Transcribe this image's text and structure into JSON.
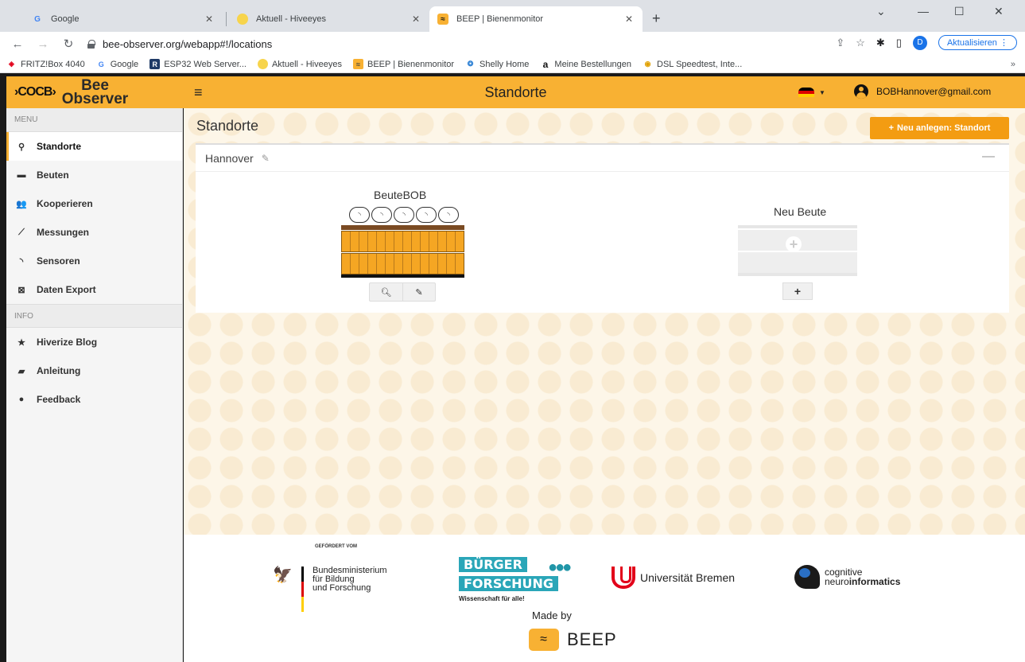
{
  "browser": {
    "tabs": [
      {
        "title": "Google",
        "favicon": "G"
      },
      {
        "title": "Aktuell - Hiveeyes",
        "favicon": ""
      },
      {
        "title": "BEEP | Bienenmonitor",
        "favicon": ""
      }
    ],
    "url": "bee-observer.org/webapp#!/locations",
    "update_label": "Aktualisieren",
    "profile_initial": "D",
    "bookmarks": [
      {
        "label": "FRITZ!Box 4040",
        "icon": "fritz-icon"
      },
      {
        "label": "Google",
        "icon": "G"
      },
      {
        "label": "ESP32 Web Server...",
        "icon": "R"
      },
      {
        "label": "Aktuell - Hiveeyes",
        "icon": "hiveeyes-icon"
      },
      {
        "label": "BEEP | Bienenmonitor",
        "icon": "beep-icon"
      },
      {
        "label": "Shelly Home",
        "icon": "shelly-icon"
      },
      {
        "label": "Meine Bestellungen",
        "icon": "a"
      },
      {
        "label": "DSL Speedtest, Inte...",
        "icon": "speedtest-icon"
      }
    ]
  },
  "header": {
    "logo_line1": "Bee",
    "logo_line2": "Observer",
    "logo_mark": "›COCB›",
    "title": "Standorte",
    "user_email": "BOBHannover@gmail.com",
    "accent_color": "#f8b133"
  },
  "sidebar": {
    "menu_header": "MENU",
    "info_header": "INFO",
    "menu_items": [
      {
        "label": "Standorte",
        "icon": "map-marker-icon",
        "active": true
      },
      {
        "label": "Beuten",
        "icon": "archive-icon"
      },
      {
        "label": "Kooperieren",
        "icon": "users-icon"
      },
      {
        "label": "Messungen",
        "icon": "line-chart-icon"
      },
      {
        "label": "Sensoren",
        "icon": "rss-icon"
      },
      {
        "label": "Daten Export",
        "icon": "export-icon"
      }
    ],
    "info_items": [
      {
        "label": "Hiverize Blog",
        "icon": "star-icon"
      },
      {
        "label": "Anleitung",
        "icon": "book-icon"
      },
      {
        "label": "Feedback",
        "icon": "comment-icon"
      }
    ]
  },
  "main": {
    "page_title": "Standorte",
    "new_button_label": "Neu anlegen: Standort",
    "location": {
      "name": "Hannover",
      "hives": [
        {
          "name": "BeuteBOB",
          "sensor_count": 5
        }
      ],
      "new_hive_label": "Neu Beute"
    }
  },
  "footer": {
    "funded_by": "GEFÖRDERT VOM",
    "bmbf_line1": "Bundesministerium",
    "bmbf_line2": "für Bildung",
    "bmbf_line3": "und Forschung",
    "buerger_line1": "BÜRGER",
    "buerger_line2": "FORSCHUNG",
    "buerger_sub": "Wissenschaft für alle!",
    "uni_bremen": "Universität Bremen",
    "cn_line1": "cognitive",
    "cn_line2_light": "neuro",
    "cn_line2_bold": "informatics",
    "made_by": "Made by",
    "beep": "BEEP"
  }
}
